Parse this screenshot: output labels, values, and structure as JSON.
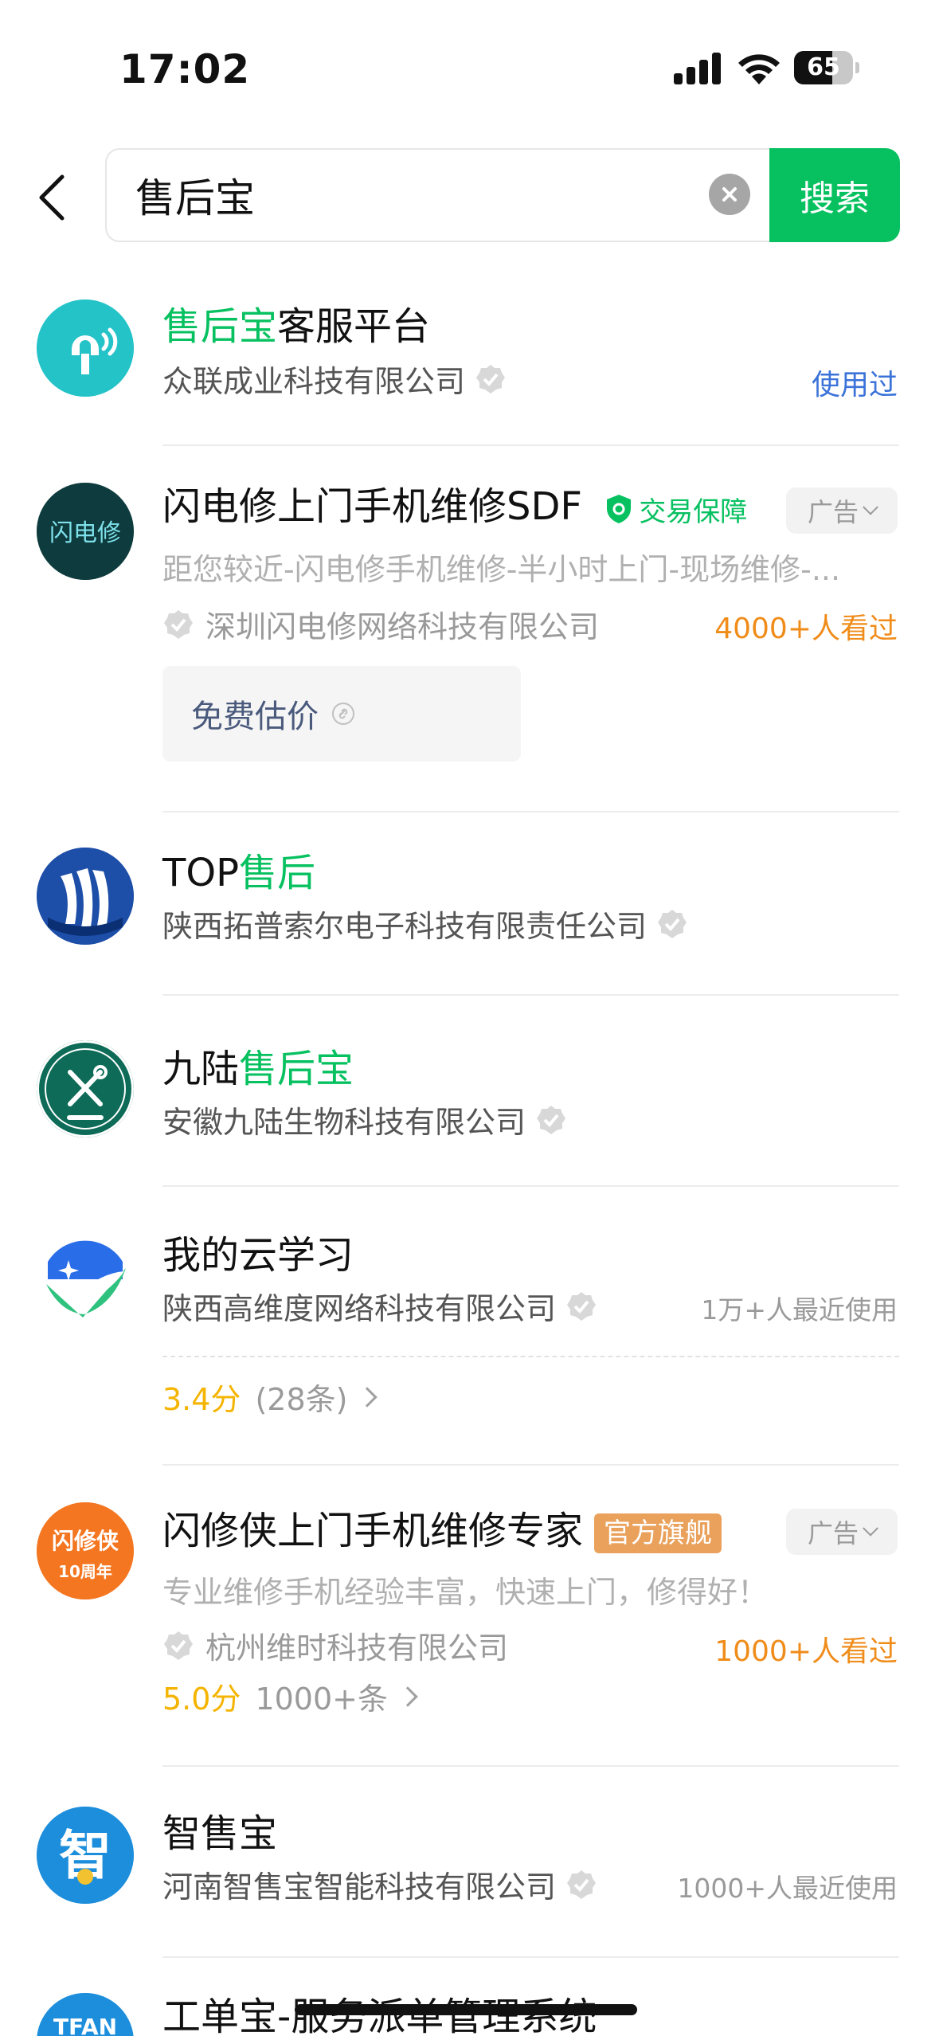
{
  "status_bar": {
    "time": "17:02",
    "battery": "65",
    "battery_level": 0.65
  },
  "search": {
    "query": "售后宝",
    "button_label": "搜索"
  },
  "results": [
    {
      "title_hl": "售后宝",
      "title_rest": "客服平台",
      "company": "众联成业科技有限公司",
      "right_note": "使用过"
    },
    {
      "title": "闪电修上门手机维修SDF",
      "guarantee": "交易保障",
      "ad": "广告",
      "avatar_text": "闪电修",
      "desc": "距您较近-闪电修手机维修-半小时上门-现场维修-...",
      "company": "深圳闪电修网络科技有限公司",
      "right_note": "4000+人看过",
      "action": "免费估价"
    },
    {
      "title_pre": "TOP",
      "title_hl": "售后",
      "company": "陕西拓普索尔电子科技有限责任公司"
    },
    {
      "title_pre": "九陆",
      "title_hl": "售后宝",
      "company": "安徽九陆生物科技有限公司"
    },
    {
      "title": "我的云学习",
      "company": "陕西高维度网络科技有限公司",
      "right_note": "1万+人最近使用",
      "score": "3.4分",
      "count": "(28条)"
    },
    {
      "title": "闪修侠上门手机维修专家",
      "tag": "官方旗舰",
      "ad": "广告",
      "avatar_text_1": "闪修侠",
      "avatar_text_2": "10周年",
      "desc": "专业维修手机经验丰富，快速上门，修得好！",
      "company": "杭州维时科技有限公司",
      "right_note": "1000+人看过",
      "score": "5.0分",
      "count": "1000+条"
    },
    {
      "title": "智售宝",
      "avatar_text": "智",
      "company": "河南智售宝智能科技有限公司",
      "right_note": "1000+人最近使用"
    },
    {
      "title": "工单宝-服务派单管理系统",
      "avatar_text": "TFAN"
    }
  ],
  "colors": {
    "accent": "#07c160",
    "rating": "#f4b400",
    "link": "#3b73d9",
    "views": "#f08c1a"
  }
}
